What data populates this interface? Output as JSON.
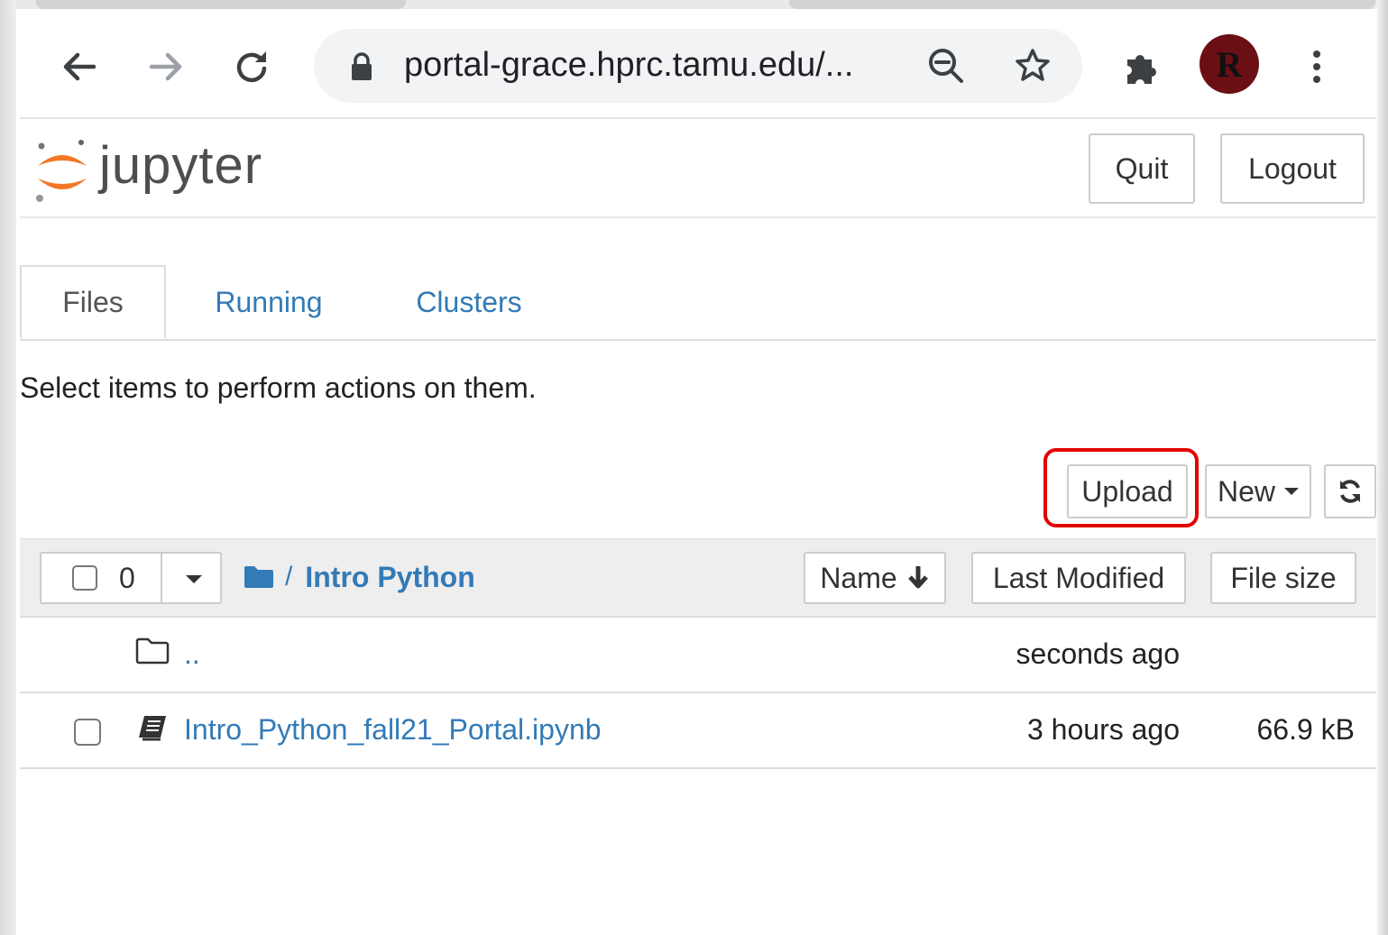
{
  "browser": {
    "url": "portal-grace.hprc.tamu.edu/...",
    "avatar_letter": "R",
    "accent_color": "#6b0f14"
  },
  "jupyter": {
    "logo_text": "jupyter",
    "quit_label": "Quit",
    "logout_label": "Logout"
  },
  "tabs": [
    {
      "label": "Files",
      "active": true
    },
    {
      "label": "Running",
      "active": false
    },
    {
      "label": "Clusters",
      "active": false
    }
  ],
  "hint": "Select items to perform actions on them.",
  "actions": {
    "upload_label": "Upload",
    "new_label": "New",
    "highlight_color": "#e30000"
  },
  "list": {
    "selected_count": "0",
    "breadcrumb_sep": "/",
    "folder": "Intro Python",
    "sort_name": "Name",
    "sort_modified": "Last Modified",
    "sort_size": "File size"
  },
  "rows": [
    {
      "name": "..",
      "modified": "seconds ago",
      "size": "",
      "icon": "folder-icon"
    },
    {
      "name": "Intro_Python_fall21_Portal.ipynb",
      "modified": "3 hours ago",
      "size": "66.9 kB",
      "icon": "notebook-icon"
    }
  ]
}
